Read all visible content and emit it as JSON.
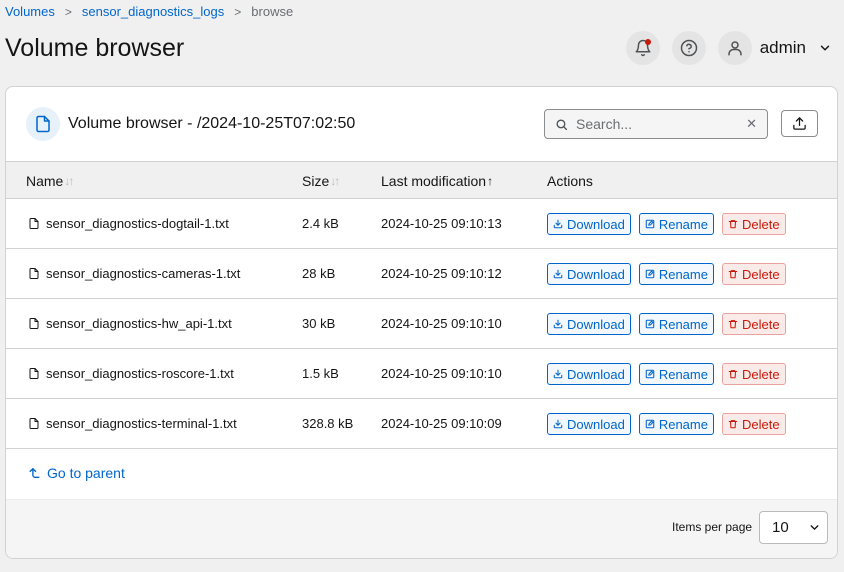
{
  "breadcrumb": {
    "items": [
      "Volumes",
      "sensor_diagnostics_logs"
    ],
    "current": "browse",
    "separator": ">"
  },
  "page": {
    "title": "Volume browser"
  },
  "user": {
    "name": "admin"
  },
  "card": {
    "title": "Volume browser - /2024-10-25T07:02:50",
    "search_placeholder": "Search...",
    "clear_glyph": "✕"
  },
  "table": {
    "headers": {
      "name": "Name",
      "size": "Size",
      "modified": "Last modification",
      "actions": "Actions"
    },
    "sort_glyph": "↓↑",
    "active_sort_glyph": "↑",
    "rows": [
      {
        "name": "sensor_diagnostics-dogtail-1.txt",
        "size": "2.4 kB",
        "modified": "2024-10-25 09:10:13"
      },
      {
        "name": "sensor_diagnostics-cameras-1.txt",
        "size": "28 kB",
        "modified": "2024-10-25 09:10:12"
      },
      {
        "name": "sensor_diagnostics-hw_api-1.txt",
        "size": "30 kB",
        "modified": "2024-10-25 09:10:10"
      },
      {
        "name": "sensor_diagnostics-roscore-1.txt",
        "size": "1.5 kB",
        "modified": "2024-10-25 09:10:10"
      },
      {
        "name": "sensor_diagnostics-terminal-1.txt",
        "size": "328.8 kB",
        "modified": "2024-10-25 09:10:09"
      }
    ],
    "action_labels": {
      "download": "Download",
      "rename": "Rename",
      "delete": "Delete"
    }
  },
  "go_parent": "Go to parent",
  "pagination": {
    "label": "Items per page",
    "value": "10"
  },
  "colors": {
    "accent": "#0066cc",
    "danger": "#c9190b",
    "notification_dot": "#c9190b"
  }
}
